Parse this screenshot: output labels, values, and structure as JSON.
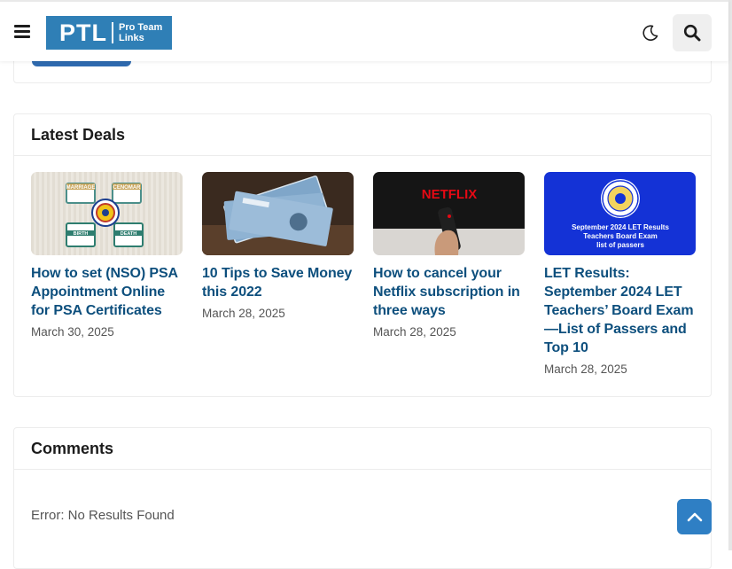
{
  "header": {
    "logo": {
      "mark": "PTL",
      "line1": "Pro Team",
      "line2": "Links"
    },
    "icons": [
      "menu-icon",
      "moon-icon",
      "search-icon"
    ]
  },
  "latest_deals": {
    "title": "Latest Deals",
    "items": [
      {
        "title": "How to set (NSO) PSA Appointment Online for PSA Certificates",
        "date": "March 30, 2025",
        "image_labels": [
          "MARRIAGE",
          "CENOMAR",
          "BIRTH",
          "DEATH"
        ]
      },
      {
        "title": "10 Tips to Save Money this 2022",
        "date": "March 28, 2025"
      },
      {
        "title": "How to cancel your Netflix subscription in three ways",
        "date": "March 28, 2025",
        "image_labels": [
          "NETFLIX"
        ]
      },
      {
        "title": "LET Results: September 2024 LET Teachers’ Board Exam—List of Passers and Top 10",
        "date": "March 28, 2025",
        "image_labels": [
          "September 2024 LET Results",
          "Teachers Board Exam",
          "list of passers"
        ]
      }
    ]
  },
  "comments": {
    "title": "Comments",
    "error_label": "Error:",
    "error_message": "No Results Found"
  },
  "colors": {
    "accent": "#2f7fc4",
    "link": "#0d4f7d",
    "logo_bg": "#2f7fb6",
    "let_bg": "#1432d6",
    "netflix_red": "#e50914"
  }
}
